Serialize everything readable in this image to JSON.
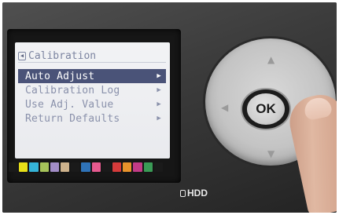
{
  "lcd": {
    "title": "Calibration",
    "back_icon": "back-arrow-icon",
    "menu_items": [
      {
        "label": "Auto Adjust",
        "selected": true
      },
      {
        "label": "Calibration Log",
        "selected": false
      },
      {
        "label": "Use Adj. Value",
        "selected": false
      },
      {
        "label": "Return Defaults",
        "selected": false
      }
    ],
    "arrow_glyph": "▶"
  },
  "color_palette": [
    "#1a1a1a",
    "#e7e019",
    "#35b4d8",
    "#a6c35a",
    "#a28dc6",
    "#cdb28c",
    "#1a1a1a",
    "#2f73b8",
    "#e65a8f",
    "#1a1a1a",
    "#d53b3b",
    "#e8932b",
    "#c23b86",
    "#3a9b56",
    "#1a1a1a"
  ],
  "panel": {
    "hdd_label": "HDD",
    "ok_label": "OK"
  }
}
